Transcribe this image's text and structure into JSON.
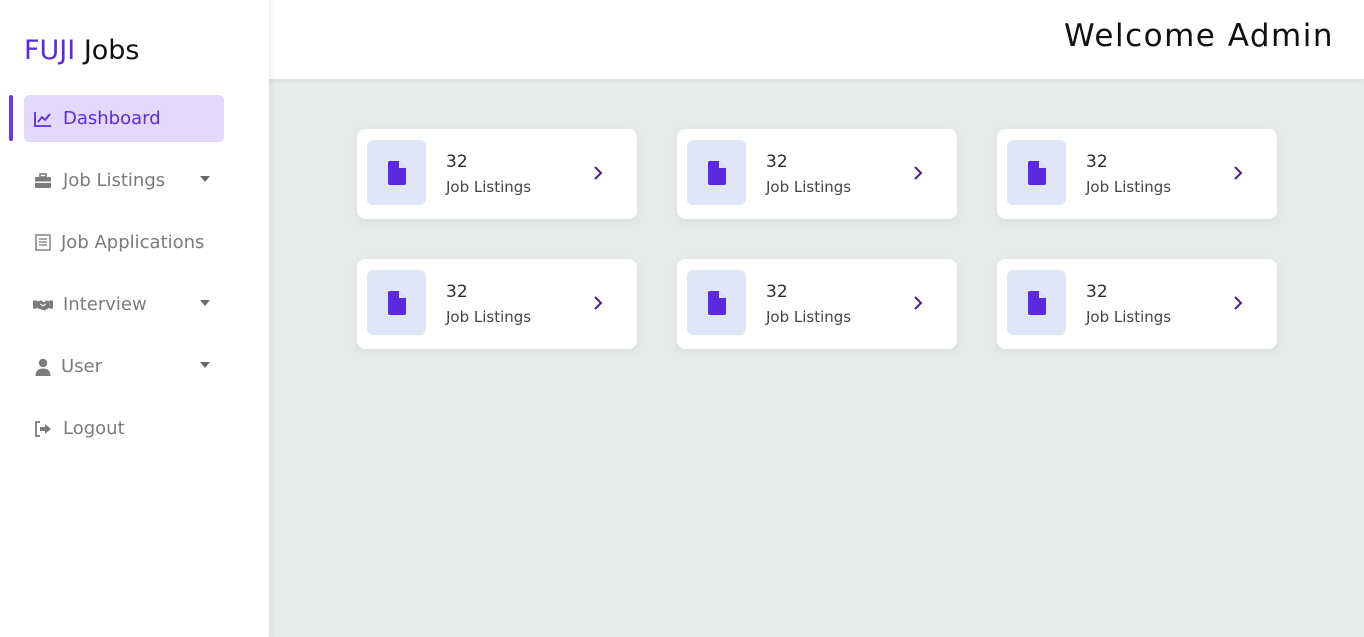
{
  "brand": {
    "part1": "FUJI",
    "part2": "Jobs"
  },
  "header": {
    "welcome": "Welcome Admin"
  },
  "sidebar": {
    "items": [
      {
        "label": "Dashboard",
        "icon": "chart-line-icon",
        "active": true,
        "has_caret": false
      },
      {
        "label": "Job Listings",
        "icon": "briefcase-icon",
        "active": false,
        "has_caret": true
      },
      {
        "label": "Job Applications",
        "icon": "document-list-icon",
        "active": false,
        "has_caret": false
      },
      {
        "label": "Interview",
        "icon": "handshake-icon",
        "active": false,
        "has_caret": true
      },
      {
        "label": "User",
        "icon": "user-icon",
        "active": false,
        "has_caret": true
      },
      {
        "label": "Logout",
        "icon": "logout-icon",
        "active": false,
        "has_caret": false
      }
    ]
  },
  "cards": [
    {
      "count": "32",
      "label": "Job Listings",
      "icon": "file-icon"
    },
    {
      "count": "32",
      "label": "Job Listings",
      "icon": "file-icon"
    },
    {
      "count": "32",
      "label": "Job Listings",
      "icon": "file-icon"
    },
    {
      "count": "32",
      "label": "Job Listings",
      "icon": "file-icon"
    },
    {
      "count": "32",
      "label": "Job Listings",
      "icon": "file-icon"
    },
    {
      "count": "32",
      "label": "Job Listings",
      "icon": "file-icon"
    }
  ],
  "colors": {
    "accent": "#5b2ae0",
    "active_bg": "#e2d9fd",
    "content_bg": "#e7ecea",
    "icon_box_bg": "#e1e6f6",
    "chevron": "#4a1e8a"
  }
}
